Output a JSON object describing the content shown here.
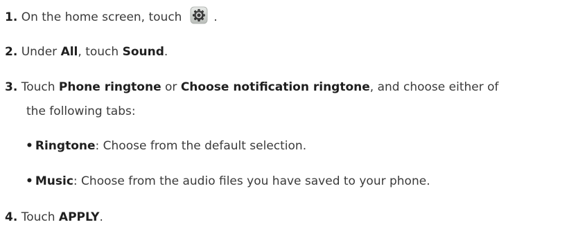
{
  "steps": [
    {
      "number": "1.",
      "text_before": "On the home screen, touch",
      "icon": "settings-gear-icon",
      "text_after": "."
    },
    {
      "number": "2.",
      "t1": "Under ",
      "b1": "All",
      "t2": ", touch ",
      "b2": "Sound",
      "t3": "."
    },
    {
      "number": "3.",
      "t1": "Touch ",
      "b1": "Phone ringtone",
      "t2": " or ",
      "b2": "Choose notification ringtone",
      "t3": ", and choose either of",
      "cont": "the following tabs:"
    },
    {
      "number": "4.",
      "t1": "Touch ",
      "b1": "APPLY",
      "t2": "."
    }
  ],
  "bullets": [
    {
      "symbol": "•",
      "label": "Ringtone",
      "text": ": Choose from the default selection."
    },
    {
      "symbol": "•",
      "label": "Music",
      "text": ": Choose from the audio files you have saved to your phone."
    }
  ]
}
